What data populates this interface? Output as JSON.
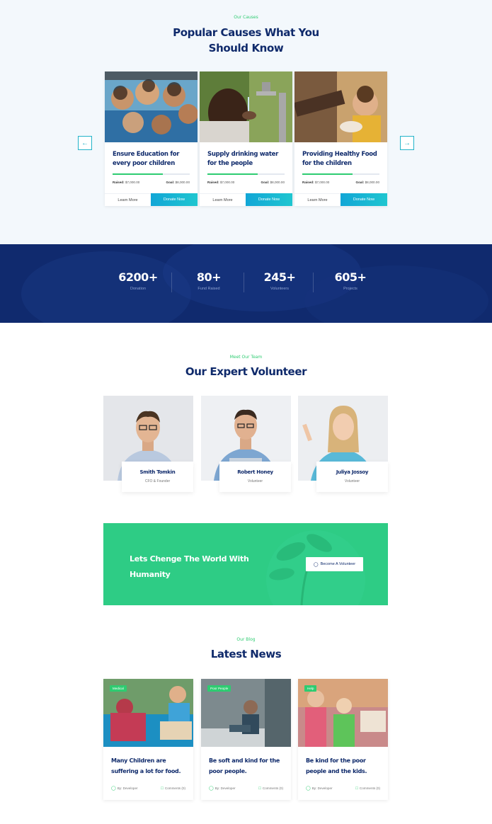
{
  "causes": {
    "eyebrow": "Our Causes",
    "title_line1": "Popular Causes What You",
    "title_line2": "Should Know",
    "prev_icon": "arrow-left-icon",
    "next_icon": "arrow-right-icon",
    "accent": "#2ecc71",
    "button_gradient": [
      "#12a6d6",
      "#1fc6d0"
    ],
    "items": [
      {
        "title": "Ensure Education for every poor children",
        "raised_label": "Raised:",
        "raised_value": "$7,000.00",
        "goal_label": "Goal:",
        "goal_value": "$8,000.00",
        "progress": 0.65,
        "learn_label": "Learn More",
        "donate_label": "Donate Now"
      },
      {
        "title": "Supply drinking water for the people",
        "raised_label": "Raised:",
        "raised_value": "$7,000.00",
        "goal_label": "Goal:",
        "goal_value": "$8,000.00",
        "progress": 0.65,
        "learn_label": "Learn More",
        "donate_label": "Donate Now"
      },
      {
        "title": "Providing Healthy Food for the children",
        "raised_label": "Raised:",
        "raised_value": "$7,000.00",
        "goal_label": "Goal:",
        "goal_value": "$8,000.00",
        "progress": 0.65,
        "learn_label": "Learn More",
        "donate_label": "Donate Now"
      }
    ]
  },
  "stats": {
    "background": "#102a6e",
    "items": [
      {
        "value": "6200+",
        "label": "Donation"
      },
      {
        "value": "80+",
        "label": "Fund Raised"
      },
      {
        "value": "245+",
        "label": "Volunteers"
      },
      {
        "value": "605+",
        "label": "Projects"
      }
    ]
  },
  "team": {
    "eyebrow": "Meet Our Team",
    "title": "Our Expert Volunteer",
    "members": [
      {
        "name": "Smith Tomkin",
        "role": "CFO & Founder"
      },
      {
        "name": "Robert Honey",
        "role": "Volunteer"
      },
      {
        "name": "Juliya Jossoy",
        "role": "Volunteer"
      }
    ]
  },
  "banner": {
    "title": "Lets Chenge The World With Humanity",
    "button_label": "Become A Volunteer",
    "button_icon": "user-icon",
    "background": "#2ecc85"
  },
  "blog": {
    "eyebrow": "Our Blog",
    "title": "Latest News",
    "posts": [
      {
        "tag": "Medical",
        "title": "Many Children are suffering a lot for food.",
        "author": "By: Developer",
        "comments": "Comments (0)"
      },
      {
        "tag": "Poor People",
        "title": "Be soft and kind for the poor people.",
        "author": "By: Developer",
        "comments": "Comments (0)"
      },
      {
        "tag": "Help",
        "title": "Be kind for the poor people and the kids.",
        "author": "By: Developer",
        "comments": "Comments (0)"
      }
    ]
  }
}
